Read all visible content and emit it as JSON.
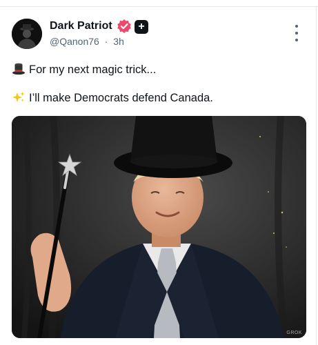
{
  "post": {
    "author_name": "Dark Patriot",
    "handle": "@Qanon76",
    "separator": "·",
    "time": "3h",
    "plus_badge": "+",
    "line1": "For my next magic trick...",
    "line2": "I’ll make Democrats defend Canada.",
    "line1_emoji": "top-hat-icon",
    "line2_emoji": "sparkles-icon",
    "image_watermark": "GROK"
  },
  "colors": {
    "verified_badge": "#f0476d",
    "text_primary": "#0f1419",
    "text_secondary": "#536471"
  }
}
